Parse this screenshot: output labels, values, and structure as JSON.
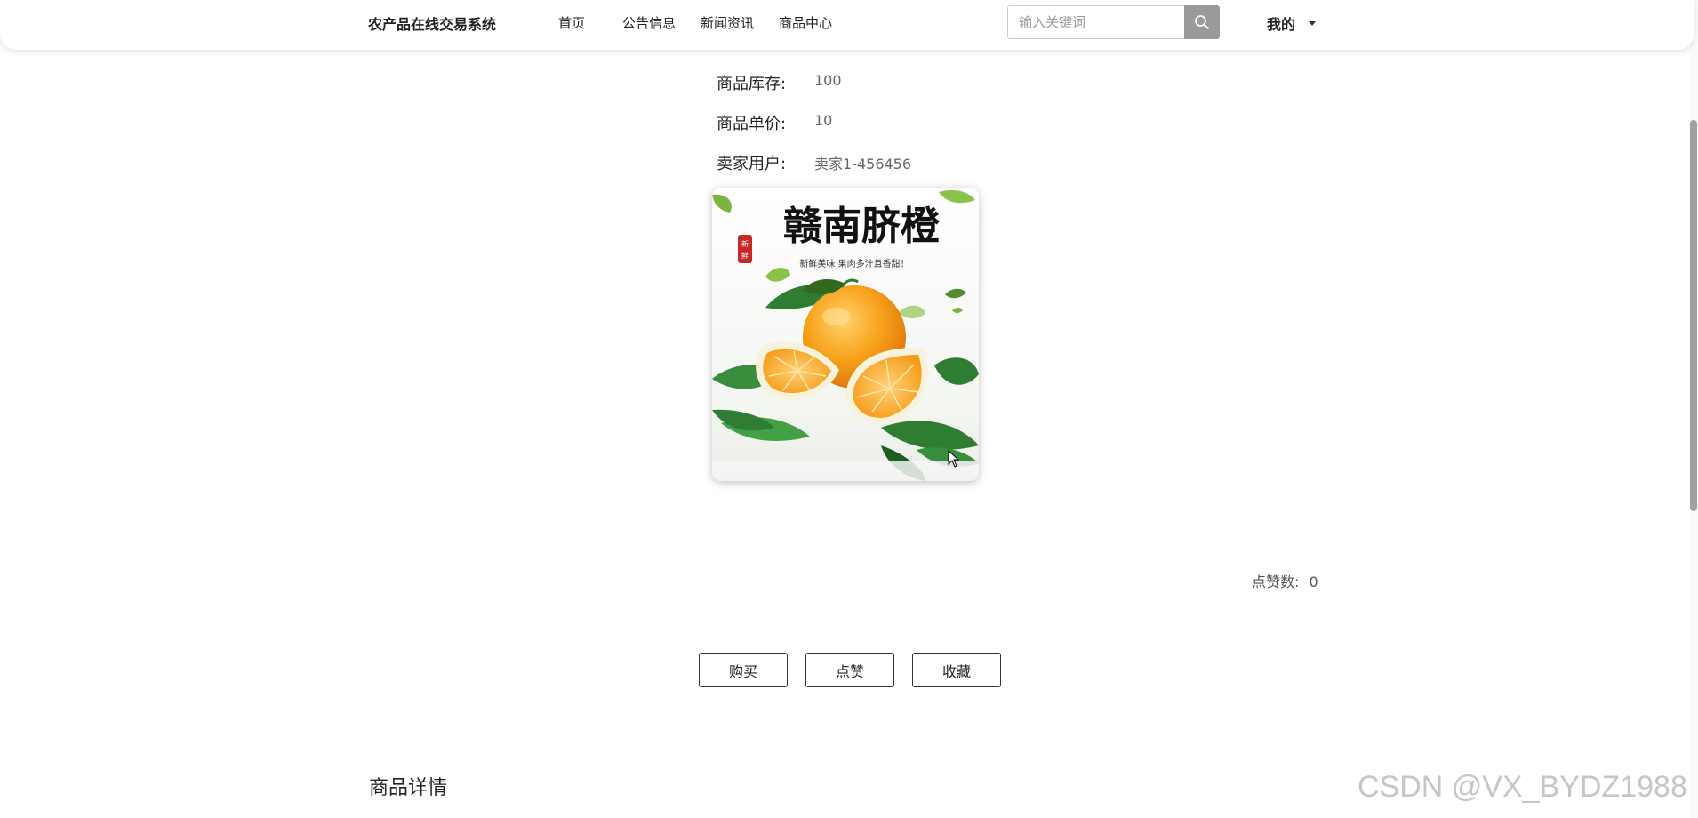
{
  "header": {
    "brand": "农产品在线交易系统",
    "nav": [
      {
        "label": "首页"
      },
      {
        "label": "公告信息"
      },
      {
        "label": "新闻资讯"
      },
      {
        "label": "商品中心"
      }
    ],
    "search": {
      "placeholder": "输入关键词",
      "value": ""
    },
    "user_menu": "我的"
  },
  "product": {
    "fields": [
      {
        "label": "商品库存:",
        "value": "100"
      },
      {
        "label": "商品单价:",
        "value": "10"
      },
      {
        "label": "卖家用户:",
        "value": "卖家1-456456"
      }
    ],
    "image": {
      "title": "赣南脐橙",
      "subtitle": "新鲜美味 果肉多汁且香甜！",
      "seal": "新鲜"
    },
    "likes_label": "点赞数:",
    "likes_value": "0"
  },
  "actions": {
    "buy": "购买",
    "like": "点赞",
    "favorite": "收藏"
  },
  "details_title": "商品详情",
  "watermark": "CSDN @VX_BYDZ1988",
  "colors": {
    "search_button": "#9a9a9a",
    "orange": "#f7a21b",
    "leaf": "#2e7d32"
  }
}
